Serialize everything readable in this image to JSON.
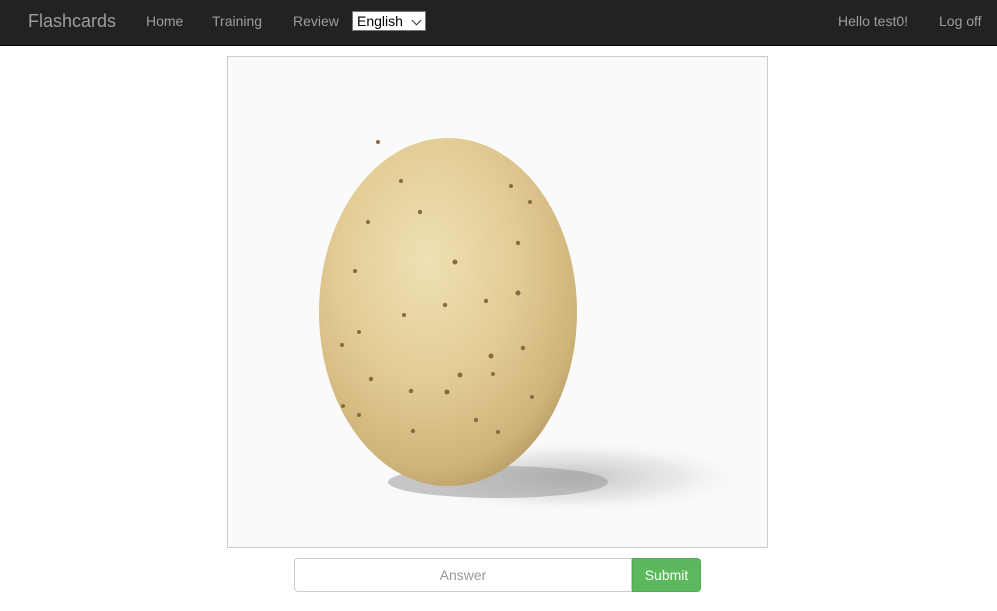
{
  "navbar": {
    "brand": "Flashcards",
    "links": [
      {
        "label": "Home"
      },
      {
        "label": "Training"
      },
      {
        "label": "Review"
      }
    ],
    "language": {
      "selected": "English"
    },
    "greeting": "Hello test0!",
    "logoff": "Log off"
  },
  "card": {
    "image_subject": "potato"
  },
  "answer": {
    "placeholder": "Answer",
    "value": "",
    "submit_label": "Submit"
  },
  "colors": {
    "navbar_bg": "#222222",
    "nav_text": "#9d9d9d",
    "submit_bg": "#5cb85c"
  }
}
